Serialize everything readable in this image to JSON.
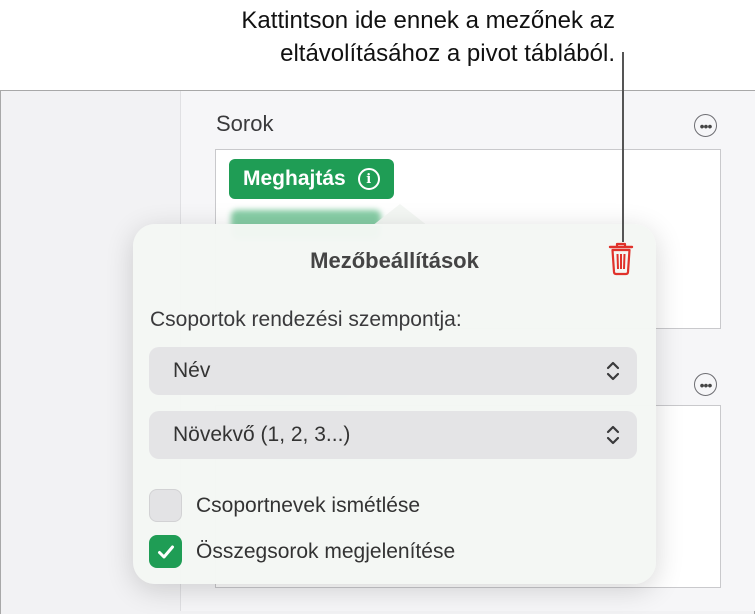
{
  "callout": {
    "line1": "Kattintson ide ennek a mezőnek az",
    "line2": "eltávolításához a pivot táblából."
  },
  "sidebar": {
    "rows_label": "Sorok",
    "rows_field_chip": "Meghajtás"
  },
  "popover": {
    "title": "Mezőbeállítások",
    "sort_label": "Csoportok rendezési szempontja:",
    "sort_by_value": "Név",
    "sort_order_value": "Növekvő (1, 2, 3...)",
    "checkboxes": [
      {
        "label": "Csoportnevek ismétlése",
        "checked": false
      },
      {
        "label": "Összegsorok megjelenítése",
        "checked": true
      }
    ]
  },
  "colors": {
    "accent_green": "#1f9d55",
    "trash_red": "#e0322b"
  },
  "icons": [
    "more-icon",
    "info-icon",
    "trash-icon",
    "chevron-updown-icon",
    "checkmark-icon"
  ]
}
